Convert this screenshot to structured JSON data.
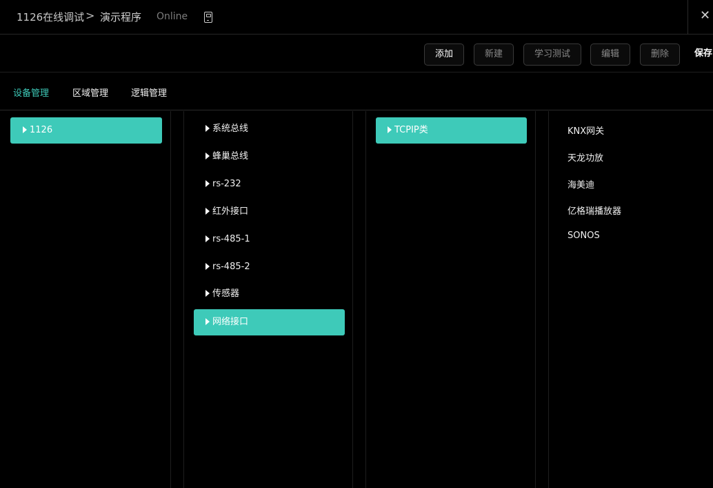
{
  "header": {
    "breadcrumb_root": "1126在线调试",
    "separator": ">",
    "page_title": "演示程序",
    "status": "Online",
    "device_icon": "phone-icon",
    "close_symbol": "✕"
  },
  "toolbar": {
    "add_label": "添加",
    "new_label": "新建",
    "learn_test_label": "学习测试",
    "edit_label": "编辑",
    "delete_label": "删除",
    "save_label": "保存"
  },
  "tabs": [
    {
      "label": "设备管理",
      "active": true
    },
    {
      "label": "区域管理",
      "active": false
    },
    {
      "label": "逻辑管理",
      "active": false
    }
  ],
  "columns": {
    "hosts": [
      {
        "label": "1126",
        "selected": true
      }
    ],
    "interfaces": [
      {
        "label": "系统总线"
      },
      {
        "label": "蜂巢总线"
      },
      {
        "label": "rs-232"
      },
      {
        "label": "红外接口"
      },
      {
        "label": "rs-485-1"
      },
      {
        "label": "rs-485-2"
      },
      {
        "label": "传感器"
      },
      {
        "label": "网络接口",
        "selected": true
      }
    ],
    "categories": [
      {
        "label": "TCPIP类",
        "selected": true
      }
    ],
    "devices": [
      {
        "label": "KNX网关"
      },
      {
        "label": "天龙功放"
      },
      {
        "label": "海美迪"
      },
      {
        "label": "亿格瑞播放器"
      },
      {
        "label": "SONOS"
      }
    ]
  },
  "colors": {
    "accent": "#3ecab9",
    "background": "#000000"
  }
}
